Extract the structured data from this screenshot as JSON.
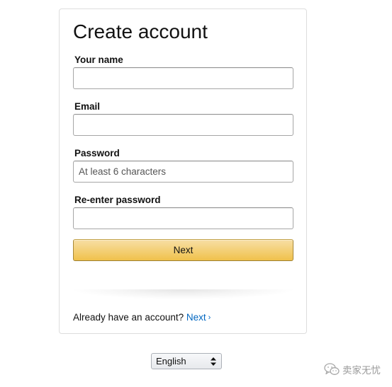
{
  "form": {
    "title": "Create account",
    "fields": [
      {
        "label": "Your name",
        "value": "",
        "placeholder": ""
      },
      {
        "label": "Email",
        "value": "",
        "placeholder": ""
      },
      {
        "label": "Password",
        "value": "",
        "placeholder": "At least 6 characters"
      },
      {
        "label": "Re-enter password",
        "value": "",
        "placeholder": ""
      }
    ],
    "submit_label": "Next",
    "signin_prompt": "Already have an account?",
    "signin_link": "Next",
    "signin_chevron": "›"
  },
  "footer": {
    "language": "English"
  },
  "watermark": {
    "text": "卖家无忧"
  },
  "colors": {
    "button_top": "#f7dfa5",
    "button_bottom": "#f0c14b",
    "link": "#0066c0",
    "card_border": "#dddddd"
  },
  "icons": [
    "chevron-right-icon",
    "select-updown-icon",
    "wechat-icon"
  ]
}
